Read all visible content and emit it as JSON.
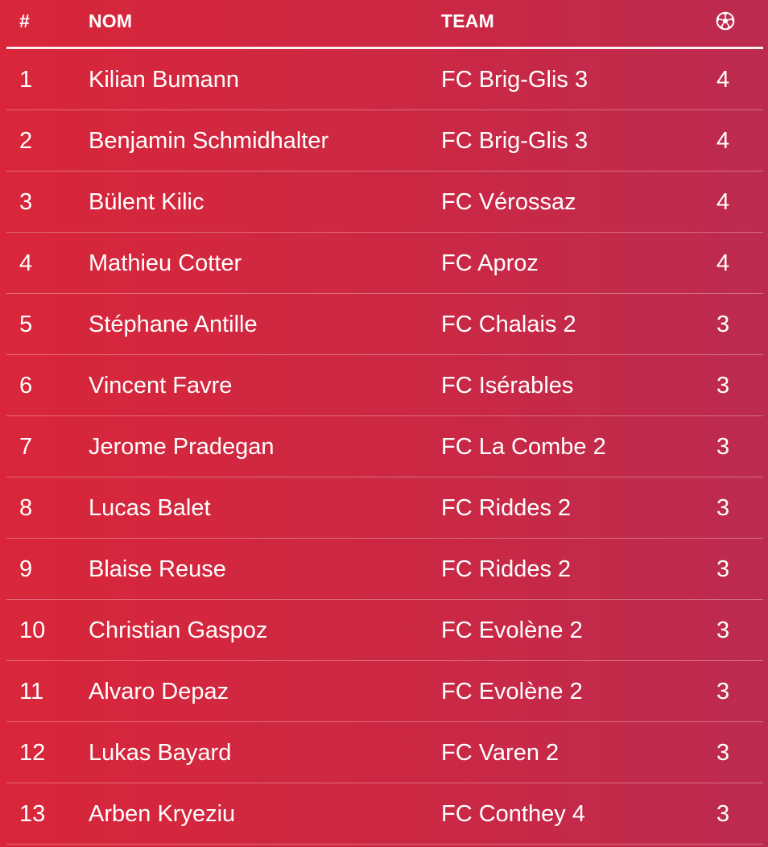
{
  "table": {
    "headers": {
      "rank": "#",
      "name": "NOM",
      "team": "TEAM",
      "goals_icon": "soccer-ball-icon"
    },
    "rows": [
      {
        "rank": "1",
        "name": "Kilian Bumann",
        "team": "FC Brig-Glis 3",
        "goals": "4"
      },
      {
        "rank": "2",
        "name": "Benjamin Schmidhalter",
        "team": "FC Brig-Glis 3",
        "goals": "4"
      },
      {
        "rank": "3",
        "name": "Bülent Kilic",
        "team": "FC Vérossaz",
        "goals": "4"
      },
      {
        "rank": "4",
        "name": "Mathieu Cotter",
        "team": "FC Aproz",
        "goals": "4"
      },
      {
        "rank": "5",
        "name": "Stéphane Antille",
        "team": "FC Chalais 2",
        "goals": "3"
      },
      {
        "rank": "6",
        "name": "Vincent Favre",
        "team": "FC Isérables",
        "goals": "3"
      },
      {
        "rank": "7",
        "name": "Jerome Pradegan",
        "team": "FC La Combe 2",
        "goals": "3"
      },
      {
        "rank": "8",
        "name": "Lucas Balet",
        "team": "FC Riddes 2",
        "goals": "3"
      },
      {
        "rank": "9",
        "name": "Blaise Reuse",
        "team": "FC Riddes 2",
        "goals": "3"
      },
      {
        "rank": "10",
        "name": "Christian Gaspoz",
        "team": "FC Evolène 2",
        "goals": "3"
      },
      {
        "rank": "11",
        "name": "Alvaro Depaz",
        "team": "FC Evolène 2",
        "goals": "3"
      },
      {
        "rank": "12",
        "name": "Lukas Bayard",
        "team": "FC Varen 2",
        "goals": "3"
      },
      {
        "rank": "13",
        "name": "Arben Kryeziu",
        "team": "FC Conthey 4",
        "goals": "3"
      }
    ]
  },
  "colors": {
    "background_left": "#d9263a",
    "background_right": "#bc2b4f",
    "text": "#ffffff"
  }
}
